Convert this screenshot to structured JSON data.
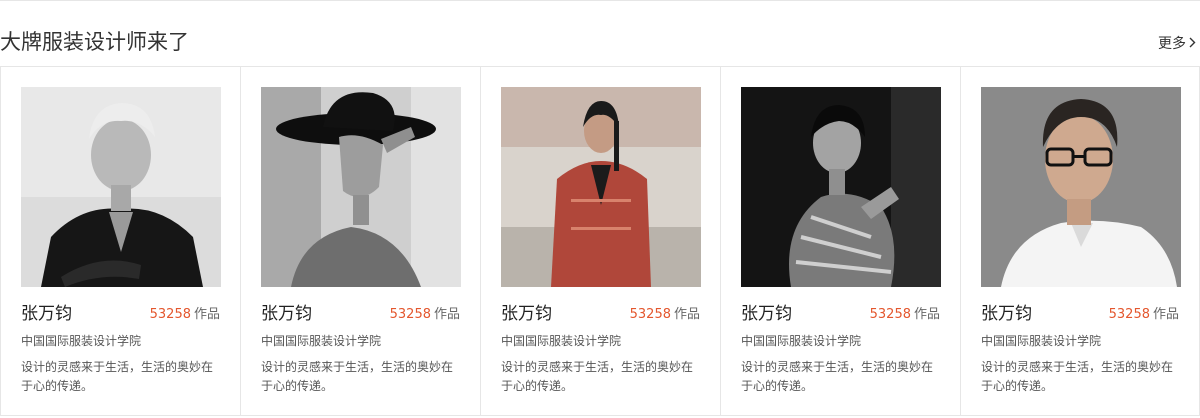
{
  "section": {
    "title": "大牌服装设计师来了",
    "more_label": "更多"
  },
  "designers": [
    {
      "name": "张万钧",
      "works_count": "53258",
      "works_unit": "作品",
      "school": "中国国际服装设计学院",
      "motto": "设计的灵感来于生活，生活的奥妙在于心的传递。",
      "photo": "portrait-man-grey-hair"
    },
    {
      "name": "张万钧",
      "works_count": "53258",
      "works_unit": "作品",
      "school": "中国国际服装设计学院",
      "motto": "设计的灵感来于生活，生活的奥妙在于心的传递。",
      "photo": "portrait-woman-black-hat"
    },
    {
      "name": "张万钧",
      "works_count": "53258",
      "works_unit": "作品",
      "school": "中国国际服装设计学院",
      "motto": "设计的灵感来于生活，生活的奥妙在于心的传递。",
      "photo": "portrait-man-red-suit"
    },
    {
      "name": "张万钧",
      "works_count": "53258",
      "works_unit": "作品",
      "school": "中国国际服装设计学院",
      "motto": "设计的灵感来于生活，生活的奥妙在于心的传递。",
      "photo": "portrait-woman-patterned-dress"
    },
    {
      "name": "张万钧",
      "works_count": "53258",
      "works_unit": "作品",
      "school": "中国国际服装设计学院",
      "motto": "设计的灵感来于生活，生活的奥妙在于心的传递。",
      "photo": "portrait-man-glasses"
    }
  ],
  "colors": {
    "accent": "#e4572e",
    "border": "#e6e6e6",
    "text": "#333333"
  }
}
